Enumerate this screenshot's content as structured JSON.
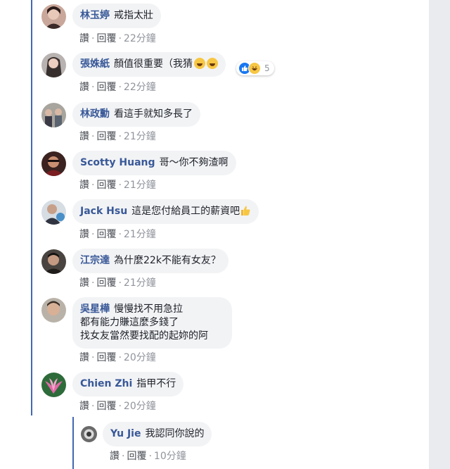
{
  "labels": {
    "like": "讚",
    "reply": "回覆",
    "dot": "·"
  },
  "comments": [
    {
      "author": "林玉婷",
      "text": "戒指太壯",
      "time": "22分鐘"
    },
    {
      "author": "張姝紙",
      "text": "顏值很重要（我猜",
      "time": "22分鐘",
      "emojis": [
        "grinning-face-emoji",
        "grinning-face-emoji"
      ],
      "reactions": {
        "types": [
          "like-icon",
          "haha-icon"
        ],
        "count": "5"
      }
    },
    {
      "author": "林政勳",
      "text": "看這手就知多長了",
      "time": "21分鐘"
    },
    {
      "author": "Scotty Huang",
      "text": "哥～你不夠渣啊",
      "time": "21分鐘"
    },
    {
      "author": "Jack Hsu",
      "text": "這是您付給員工的薪資吧",
      "time": "21分鐘",
      "emojis": [
        "thumbs-up-emoji"
      ]
    },
    {
      "author": "江宗達",
      "text": "為什麼22k不能有女友？",
      "time": "21分鐘"
    },
    {
      "author": "吳星樺",
      "text": "慢慢找不用急拉",
      "lines": [
        "都有能力賺這麼多錢了",
        "找女友當然要找配的起妳的阿"
      ],
      "time": "20分鐘"
    },
    {
      "author": "Chien Zhi",
      "text": "指甲不行",
      "time": "20分鐘"
    }
  ],
  "reply": {
    "author": "Yu Jie",
    "text": "我認同你說的",
    "time": "10分鐘"
  },
  "colors": {
    "accent": "#4267b2",
    "author": "#385898",
    "bubble": "#f2f3f5",
    "muted": "#90949c"
  }
}
